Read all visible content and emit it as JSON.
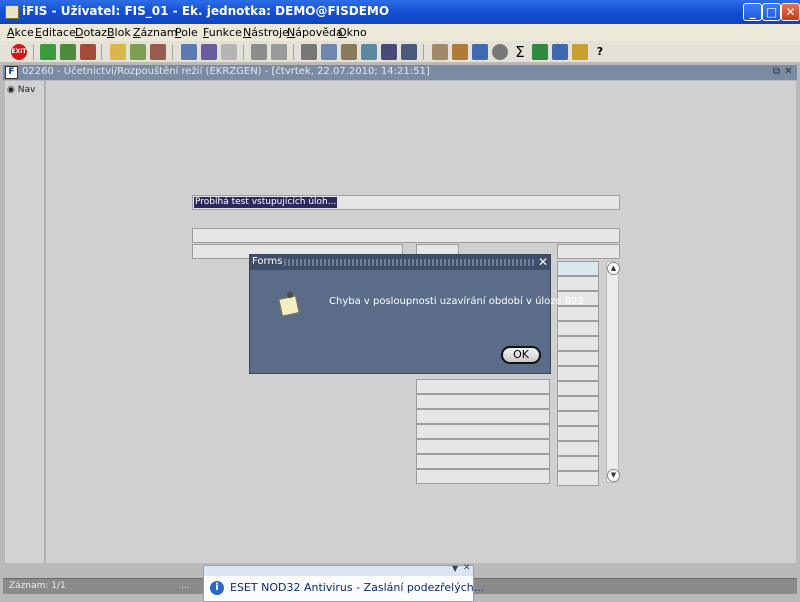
{
  "window": {
    "title": "iFIS - Uživatel: FIS_01 - Ek. jednotka: DEMO@FISDEMO",
    "minimize": "_",
    "maximize": "□",
    "close": "✕"
  },
  "menu": {
    "items": [
      "Akce",
      "Editace",
      "Dotaz",
      "Blok",
      "Záznam",
      "Pole",
      "Funkce",
      "Nástroje",
      "Nápověda",
      "Okno"
    ]
  },
  "toolbar": {
    "exit_label": "EXIT",
    "sigma_label": "Σ",
    "help_label": "?"
  },
  "child_window": {
    "title": "02260 - Účetnictví/Rozpouštění režií (EKRZGEN) - [čtvrtek, 22.07.2010; 14:21:51]",
    "restore": "⧉",
    "close": "✕"
  },
  "nav": {
    "label": "Nav"
  },
  "form": {
    "progress_text": "Probíhá test vstupujících úloh..."
  },
  "dialog": {
    "title": "Forms",
    "close": "✕",
    "message": "Chyba v posloupnosti uzavírání období v úloze 022",
    "ok_label": "OK"
  },
  "statusbar": {
    "record": "Záznam: 1/1",
    "dots": "..."
  },
  "toast": {
    "text": "ESET NOD32 Antivirus - Zaslání podezřelých...",
    "icon": "i",
    "arrow": "▼",
    "close": "✕"
  },
  "colors": {
    "titlebar": "#1652d4",
    "dialog_bg": "#5a6c88",
    "progress_highlight": "#2a2a5e"
  }
}
